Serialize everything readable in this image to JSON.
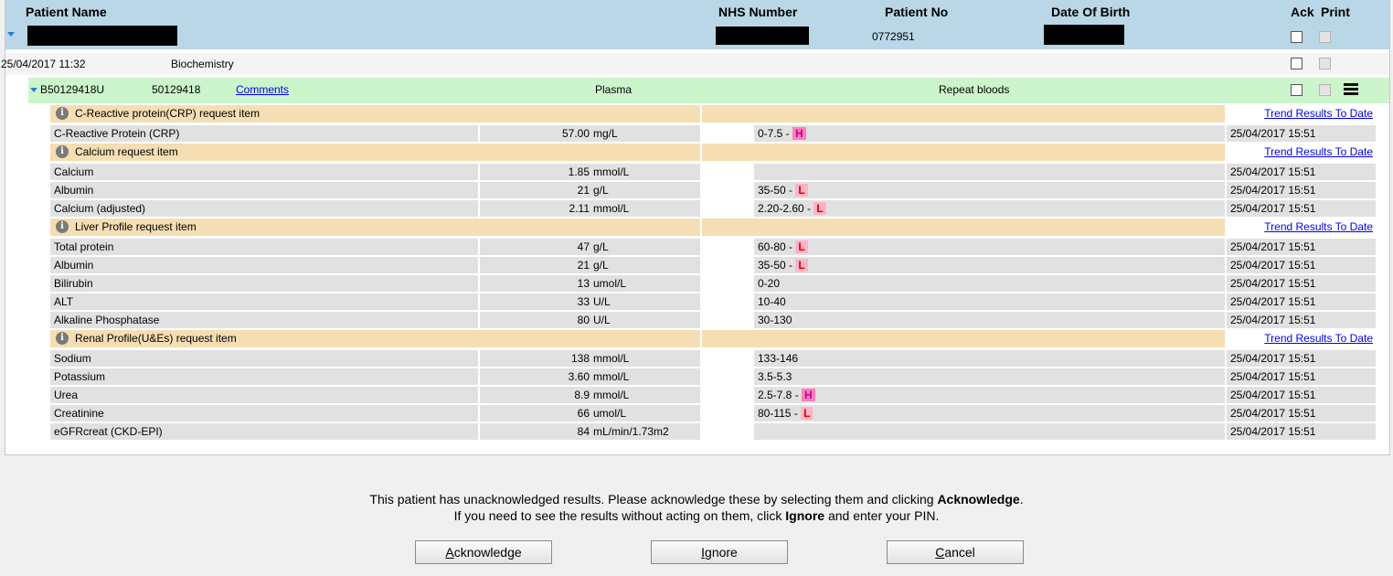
{
  "header": {
    "patient_name_label": "Patient Name",
    "nhs_number_label": "NHS Number",
    "patient_no_label": "Patient No",
    "dob_label": "Date Of Birth",
    "ack_label": "Ack",
    "print_label": "Print",
    "patient_no": "0772951"
  },
  "episode": {
    "datetime": "25/04/2017 11:32",
    "department": "Biochemistry"
  },
  "specimen": {
    "id": "B50129418U",
    "number": "50129418",
    "comments_link": "Comments",
    "type": "Plasma",
    "note": "Repeat bloods"
  },
  "trend_link": "Trend Results To Date",
  "groups": [
    {
      "title": "C-Reactive protein(CRP) request item",
      "results": [
        {
          "name": "C-Reactive Protein (CRP)",
          "value": "57.00",
          "unit": "mg/L",
          "range": "0-7.5 - ",
          "flag": "H",
          "datetime": "25/04/2017 15:51"
        }
      ]
    },
    {
      "title": "Calcium request item",
      "results": [
        {
          "name": "Calcium",
          "value": "1.85",
          "unit": "mmol/L",
          "range": "",
          "flag": "",
          "datetime": "25/04/2017 15:51"
        },
        {
          "name": "Albumin",
          "value": "21",
          "unit": "g/L",
          "range": "35-50 - ",
          "flag": "L",
          "datetime": "25/04/2017 15:51"
        },
        {
          "name": "Calcium (adjusted)",
          "value": "2.11",
          "unit": "mmol/L",
          "range": "2.20-2.60 - ",
          "flag": "L",
          "datetime": "25/04/2017 15:51"
        }
      ]
    },
    {
      "title": "Liver Profile request item",
      "results": [
        {
          "name": "Total protein",
          "value": "47",
          "unit": "g/L",
          "range": "60-80 - ",
          "flag": "L",
          "datetime": "25/04/2017 15:51"
        },
        {
          "name": "Albumin",
          "value": "21",
          "unit": "g/L",
          "range": "35-50 - ",
          "flag": "L",
          "datetime": "25/04/2017 15:51"
        },
        {
          "name": "Bilirubin",
          "value": "13",
          "unit": "umol/L",
          "range": "0-20",
          "flag": "",
          "datetime": "25/04/2017 15:51"
        },
        {
          "name": "ALT",
          "value": "33",
          "unit": "U/L",
          "range": "10-40",
          "flag": "",
          "datetime": "25/04/2017 15:51"
        },
        {
          "name": "Alkaline Phosphatase",
          "value": "80",
          "unit": "U/L",
          "range": "30-130",
          "flag": "",
          "datetime": "25/04/2017 15:51"
        }
      ]
    },
    {
      "title": "Renal Profile(U&Es) request item",
      "results": [
        {
          "name": "Sodium",
          "value": "138",
          "unit": "mmol/L",
          "range": "133-146",
          "flag": "",
          "datetime": "25/04/2017 15:51"
        },
        {
          "name": "Potassium",
          "value": "3.60",
          "unit": "mmol/L",
          "range": "3.5-5.3",
          "flag": "",
          "datetime": "25/04/2017 15:51"
        },
        {
          "name": "Urea",
          "value": "8.9",
          "unit": "mmol/L",
          "range": "2.5-7.8 - ",
          "flag": "H",
          "datetime": "25/04/2017 15:51"
        },
        {
          "name": "Creatinine",
          "value": "66",
          "unit": "umol/L",
          "range": "80-115 - ",
          "flag": "L",
          "datetime": "25/04/2017 15:51"
        },
        {
          "name": "eGFRcreat (CKD-EPI)",
          "value": "84",
          "unit": "mL/min/1.73m2",
          "range": "",
          "flag": "",
          "datetime": "25/04/2017 15:51"
        }
      ]
    }
  ],
  "message": {
    "line1_pre": "This patient has unacknowledged results. Please acknowledge these by selecting them and clicking ",
    "line1_bold": "Acknowledge",
    "line1_post": ".",
    "line2_pre": "If you need to see the results without acting on them, click ",
    "line2_bold": "Ignore",
    "line2_post": " and enter your PIN."
  },
  "buttons": {
    "acknowledge_first": "A",
    "acknowledge_rest": "cknowledge",
    "ignore_first": "I",
    "ignore_rest": "gnore",
    "cancel_first": "C",
    "cancel_rest": "ancel"
  },
  "colors": {
    "header_bg": "#b9d7e6",
    "specimen_bg": "#ccf5cc",
    "group_bg": "#f5deb3",
    "result_bg": "#e1e1e1",
    "flag_high": "#ff7fb6",
    "flag_low": "#ffb3c8"
  }
}
